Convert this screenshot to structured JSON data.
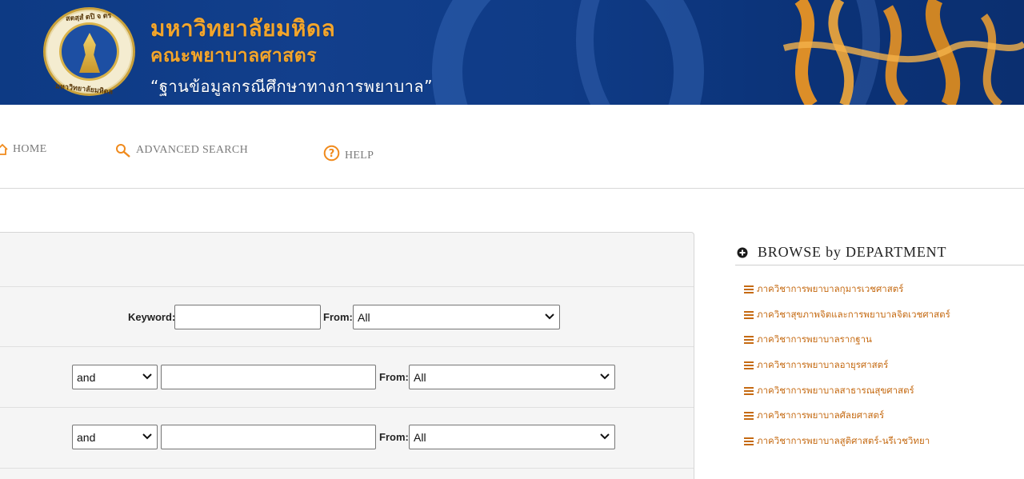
{
  "banner": {
    "university_name": "มหาวิทยาลัยมหิดล",
    "faculty_name": "คณะพยาบาลศาสตร",
    "database_title": "“ฐานข้อมูลกรณีศึกษาทางการพยาบาล”",
    "seal_ring_top": "สตสฺสํ ตปิ จ ตร",
    "seal_ring_bottom": "มหาวิทยาลัยมหิดล",
    "logo_icon": "mahidol-university-seal"
  },
  "nav": {
    "home": {
      "label": "HOME",
      "icon": "home-icon"
    },
    "advanced_search": {
      "label": "ADVANCED SEARCH",
      "icon": "search-icon"
    },
    "help": {
      "label": "HELP",
      "icon": "help-icon"
    }
  },
  "search": {
    "row1": {
      "keyword_label": "Keyword:",
      "keyword_value": "",
      "from_label": "From:",
      "from_value": "All"
    },
    "row2": {
      "operator": "and",
      "term_value": "",
      "from_label": "From:",
      "from_value": "All"
    },
    "row3": {
      "operator": "and",
      "term_value": "",
      "from_label": "From:",
      "from_value": "All"
    }
  },
  "browse": {
    "title": "BROWSE by DEPARTMENT",
    "icon": "plus-circle-icon",
    "departments": [
      {
        "label": "ภาควิชาการพยาบาลกุมารเวชศาสตร์"
      },
      {
        "label": "ภาควิชาสุขภาพจิตและการพยาบาลจิตเวชศาสตร์"
      },
      {
        "label": "ภาควิชาการพยาบาลรากฐาน"
      },
      {
        "label": "ภาควิชาการพยาบาลอายุรศาสตร์"
      },
      {
        "label": "ภาควิชาการพยาบาลสาธารณสุขศาสตร์"
      },
      {
        "label": "ภาควิชาการพยาบาลศัลยศาสตร์"
      },
      {
        "label": "ภาควิชาการพยาบาลสูติศาสตร์-นรีเวชวิทยา"
      }
    ]
  },
  "colors": {
    "banner_blue": "#0d3a84",
    "banner_gold": "#f3a52b",
    "nav_icon_orange": "#f08a1c",
    "dept_link": "#c56a12"
  }
}
